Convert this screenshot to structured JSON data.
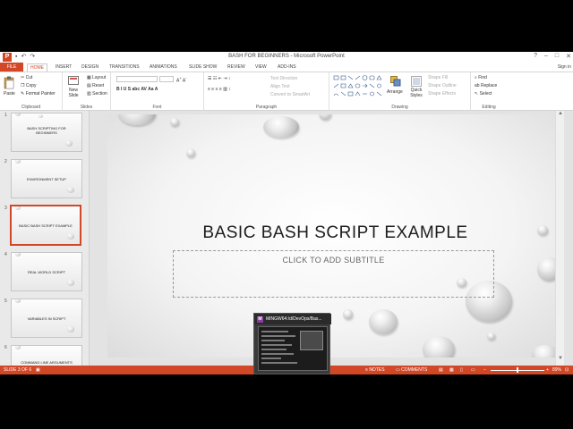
{
  "window": {
    "title": "BASH FOR BEGINNERS - Microsoft PowerPoint",
    "controls": [
      "?",
      "–",
      "□",
      "✕"
    ]
  },
  "qat": {
    "app_letter": "P",
    "save": "▪",
    "undo": "↶",
    "redo": "↷"
  },
  "tabs": [
    {
      "label": "FILE",
      "id": "file"
    },
    {
      "label": "HOME",
      "id": "home",
      "active": true
    },
    {
      "label": "INSERT",
      "id": "insert"
    },
    {
      "label": "DESIGN",
      "id": "design"
    },
    {
      "label": "TRANSITIONS",
      "id": "transitions"
    },
    {
      "label": "ANIMATIONS",
      "id": "animations"
    },
    {
      "label": "SLIDE SHOW",
      "id": "slideshow"
    },
    {
      "label": "REVIEW",
      "id": "review"
    },
    {
      "label": "VIEW",
      "id": "view"
    },
    {
      "label": "ADD-INS",
      "id": "addins"
    }
  ],
  "signin": "Sign in",
  "ribbon": {
    "clipboard": {
      "label": "Clipboard",
      "paste": "Paste",
      "cut": "Cut",
      "copy": "Copy",
      "format_painter": "Format Painter"
    },
    "slides": {
      "label": "Slides",
      "new_slide": "New Slide",
      "layout": "Layout",
      "reset": "Reset",
      "section": "Section"
    },
    "font": {
      "label": "Font",
      "buttons": "B  I  U  S  abc  AV  Aa  A"
    },
    "paragraph": {
      "label": "Paragraph",
      "text_direction": "Text Direction",
      "align_text": "Align Text",
      "smartart": "Convert to SmartArt"
    },
    "drawing": {
      "label": "Drawing",
      "arrange": "Arrange",
      "quick_styles": "Quick Styles",
      "shape_fill": "Shape Fill",
      "shape_outline": "Shape Outline",
      "shape_effects": "Shape Effects"
    },
    "editing": {
      "label": "Editing",
      "find": "Find",
      "replace": "Replace",
      "select": "Select"
    }
  },
  "thumbnails": [
    {
      "num": "1",
      "text": "BASH SCRIPTING FOR BEGINNERS"
    },
    {
      "num": "2",
      "text": "ENVIRONMENT SETUP"
    },
    {
      "num": "3",
      "text": "BASIC BASH SCRIPT EXAMPLE",
      "selected": true
    },
    {
      "num": "4",
      "text": "REAL WORLD SCRIPT"
    },
    {
      "num": "5",
      "text": "VARIABLES IN SCRIPT"
    },
    {
      "num": "6",
      "text": "COMMAND LINE ARGUMENTS"
    }
  ],
  "slide": {
    "title": "BASIC BASH SCRIPT EXAMPLE",
    "subtitle_placeholder": "CLICK TO ADD SUBTITLE"
  },
  "status": {
    "slide_info": "SLIDE 3 OF 6",
    "notes": "NOTES",
    "comments": "COMMENTS",
    "zoom": "89%"
  },
  "taskbar_popup": {
    "title": "MINGW64:/d/DevOps/Bas...",
    "icon": "M"
  },
  "colors": {
    "accent": "#D24726"
  }
}
